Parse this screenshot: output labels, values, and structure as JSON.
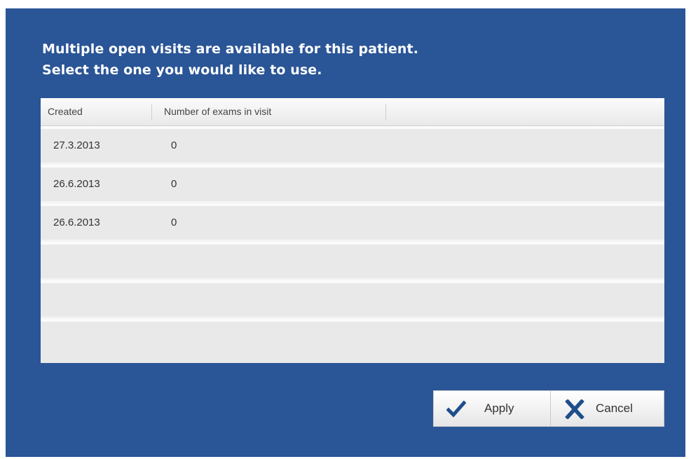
{
  "dialog": {
    "message_line1": "Multiple open visits are available for this patient.",
    "message_line2": "Select the one you would like to use."
  },
  "grid": {
    "columns": [
      "Created",
      "Number of exams in visit"
    ],
    "rows": [
      {
        "created": "27.3.2013",
        "exams": "0"
      },
      {
        "created": "26.6.2013",
        "exams": "0"
      },
      {
        "created": "26.6.2013",
        "exams": "0"
      },
      {
        "created": "",
        "exams": ""
      },
      {
        "created": "",
        "exams": ""
      },
      {
        "created": "",
        "exams": ""
      }
    ]
  },
  "buttons": {
    "apply_label": "Apply",
    "cancel_label": "Cancel",
    "apply_icon": "checkmark-icon",
    "cancel_icon": "x-icon"
  },
  "colors": {
    "background": "#2a5597",
    "icon_blue": "#1f4e8c"
  }
}
